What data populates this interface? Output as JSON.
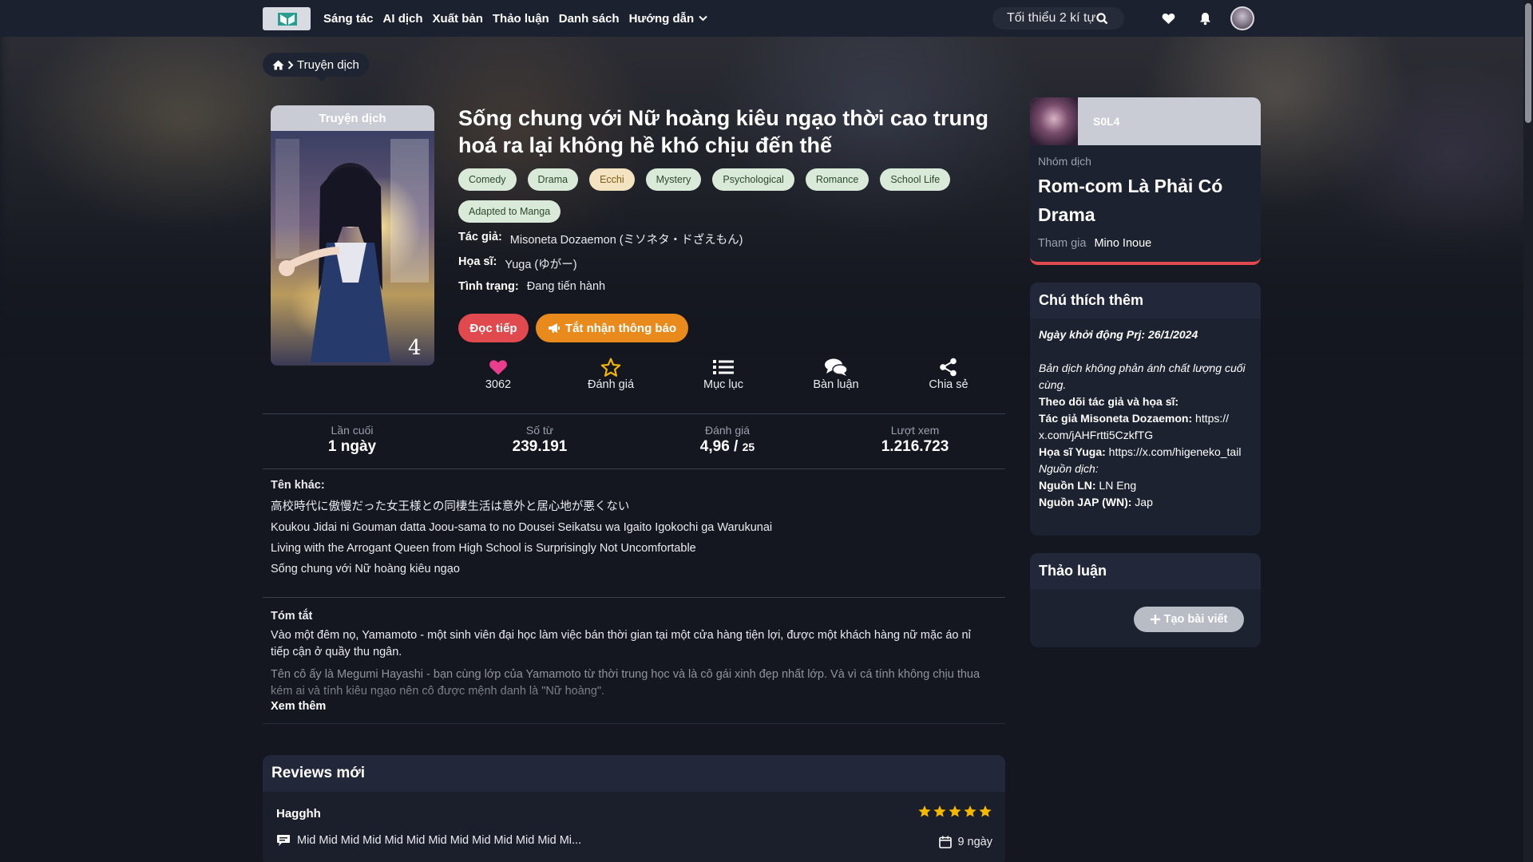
{
  "nav": {
    "items": [
      "Sáng tác",
      "AI dịch",
      "Xuất bản",
      "Thảo luận",
      "Danh sách",
      "Hướng dẫn"
    ],
    "search_placeholder": "Tối thiểu 2 kí tự"
  },
  "breadcrumb": {
    "label": "Truyện dịch"
  },
  "cover": {
    "badge": "Truyện dịch"
  },
  "novel": {
    "title": "Sống chung với Nữ hoàng kiêu ngạo thời cao trung hoá ra lại không hề khó chịu đến thế",
    "genres": [
      "Comedy",
      "Drama",
      "Ecchi",
      "Mystery",
      "Psychological",
      "Romance",
      "School Life",
      "Adapted to Manga"
    ],
    "author_label": "Tác giả:",
    "author": "Misoneta Dozaemon (ミソネタ・ドざえもん)",
    "artist_label": "Họa sĩ:",
    "artist": "Yuga (ゆがー)",
    "status_label": "Tình trạng:",
    "status": "Đang tiến hành",
    "read_button": "Đọc tiếp",
    "notify_button": "Tắt nhận thông báo"
  },
  "actions": {
    "likes": "3062",
    "rate": "Đánh giá",
    "toc": "Mục lục",
    "comments": "Bàn luận",
    "share": "Chia sẻ"
  },
  "stats": {
    "last_label": "Lần cuối",
    "last_value": "1 ngày",
    "words_label": "Số từ",
    "words_value": "239.191",
    "rating_label": "Đánh giá",
    "rating_value": "4,96 / ",
    "rating_count": "25",
    "views_label": "Lượt xem",
    "views_value": "1.216.723"
  },
  "other_names": {
    "heading": "Tên khác:",
    "names": [
      "高校時代に傲慢だった女王様との同棲生活は意外と居心地が悪くない",
      "Koukou Jidai ni Gouman datta Joou-sama to no Dousei Seikatsu wa Igaito Igokochi ga Warukunai",
      "Living with the Arrogant Queen from High School is Surprisingly Not Uncomfortable",
      "Sống chung với Nữ hoàng kiêu ngạo"
    ]
  },
  "summary": {
    "heading": "Tóm tắt",
    "p1": "Vào một đêm nọ, Yamamoto - một sinh viên đại học làm việc bán thời gian tại một cửa hàng tiện lợi, được một khách hàng nữ mặc áo nỉ tiếp cận ở quầy thu ngân.",
    "p2": "Tên cô ấy là Megumi Hayashi - bạn cùng lớp của Yamamoto từ thời trung học và là cô gái xinh đẹp nhất lớp. Và vì cá tính không chịu thua kém ai và tính kiêu ngạo nên cô được mệnh danh là \"Nữ hoàng\".",
    "see_more": "Xem thêm"
  },
  "reviews": {
    "heading": "Reviews mới",
    "user": "Hagghh",
    "rating": 5,
    "text": "Mid Mid Mid Mid Mid Mid Mid Mid Mid Mid Mid Mid Mi...",
    "time": "9 ngày"
  },
  "group": {
    "short_name": "S0L4",
    "label": "Nhóm dịch",
    "name": "Rom-com Là Phải Có Drama",
    "join_label": "Tham gia",
    "member": "Mino Inoue"
  },
  "notes": {
    "heading": "Chú thích thêm",
    "start": "Ngày khởi động Prj: 26/1/2024",
    "disclaimer": "Bản dịch không phản ánh chất lượng cuối cùng.",
    "follow": "Theo dõi tác giả và họa sĩ:",
    "author_label": "Tác giả Misoneta Dozaemon:",
    "author_link": "https:// x.com/jAHFrtti5CzkfTG",
    "artist_label": "Họa sĩ Yuga:",
    "artist_link": "https://x.com/higeneko_tail",
    "source": "Nguồn dịch:",
    "ln_label": "Nguồn LN:",
    "ln_value": "LN Eng",
    "wn_label": "Nguồn JAP (WN):",
    "wn_value": "Jap"
  },
  "discussion": {
    "heading": "Thảo luận",
    "create_button": "Tạo bài viết"
  },
  "colors": {
    "accent_red": "#e0494e",
    "accent_orange": "#e98a1d",
    "like_pink": "#e83e8c",
    "star_gold": "#f5b800"
  }
}
